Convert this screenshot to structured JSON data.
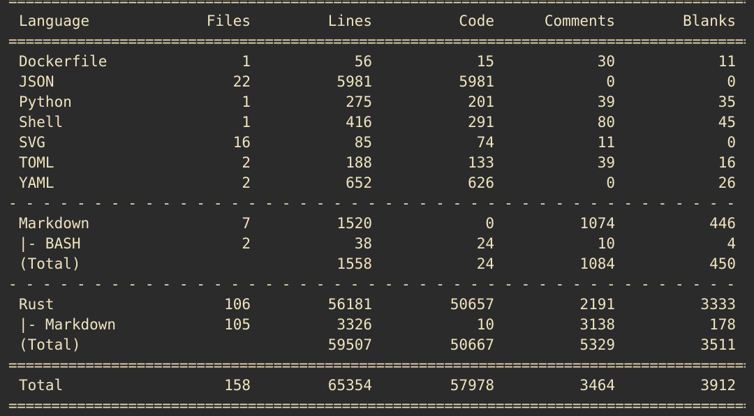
{
  "headers": {
    "language": "Language",
    "files": "Files",
    "lines": "Lines",
    "code": "Code",
    "comments": "Comments",
    "blanks": "Blanks"
  },
  "rows": [
    {
      "language": "Dockerfile",
      "files": "1",
      "lines": "56",
      "code": "15",
      "comments": "30",
      "blanks": "11"
    },
    {
      "language": "JSON",
      "files": "22",
      "lines": "5981",
      "code": "5981",
      "comments": "0",
      "blanks": "0"
    },
    {
      "language": "Python",
      "files": "1",
      "lines": "275",
      "code": "201",
      "comments": "39",
      "blanks": "35"
    },
    {
      "language": "Shell",
      "files": "1",
      "lines": "416",
      "code": "291",
      "comments": "80",
      "blanks": "45"
    },
    {
      "language": "SVG",
      "files": "16",
      "lines": "85",
      "code": "74",
      "comments": "11",
      "blanks": "0"
    },
    {
      "language": "TOML",
      "files": "2",
      "lines": "188",
      "code": "133",
      "comments": "39",
      "blanks": "16"
    },
    {
      "language": "YAML",
      "files": "2",
      "lines": "652",
      "code": "626",
      "comments": "0",
      "blanks": "26"
    }
  ],
  "markdown_group": [
    {
      "language": "Markdown",
      "files": "7",
      "lines": "1520",
      "code": "0",
      "comments": "1074",
      "blanks": "446"
    },
    {
      "language": "|- BASH",
      "files": "2",
      "lines": "38",
      "code": "24",
      "comments": "10",
      "blanks": "4"
    },
    {
      "language": "(Total)",
      "files": "",
      "lines": "1558",
      "code": "24",
      "comments": "1084",
      "blanks": "450"
    }
  ],
  "rust_group": [
    {
      "language": "Rust",
      "files": "106",
      "lines": "56181",
      "code": "50657",
      "comments": "2191",
      "blanks": "3333"
    },
    {
      "language": "|- Markdown",
      "files": "105",
      "lines": "3326",
      "code": "10",
      "comments": "3138",
      "blanks": "178"
    },
    {
      "language": "(Total)",
      "files": "",
      "lines": "59507",
      "code": "50667",
      "comments": "5329",
      "blanks": "3511"
    }
  ],
  "total": {
    "language": "Total",
    "files": "158",
    "lines": "65354",
    "code": "57978",
    "comments": "3464",
    "blanks": "3912"
  }
}
